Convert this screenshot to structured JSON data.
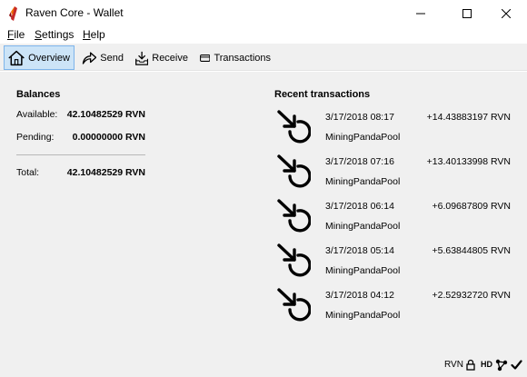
{
  "window": {
    "title": "Raven Core - Wallet"
  },
  "menu": {
    "file": "File",
    "settings": "Settings",
    "help": "Help"
  },
  "toolbar": {
    "overview": "Overview",
    "send": "Send",
    "receive": "Receive",
    "transactions": "Transactions",
    "active": "overview"
  },
  "balances": {
    "title": "Balances",
    "available_label": "Available:",
    "available_value": "42.10482529 RVN",
    "pending_label": "Pending:",
    "pending_value": "0.00000000 RVN",
    "total_label": "Total:",
    "total_value": "42.10482529 RVN"
  },
  "recent": {
    "title": "Recent transactions",
    "items": [
      {
        "date": "3/17/2018 08:17",
        "amount": "+14.43883197 RVN",
        "label": "MiningPandaPool",
        "icon": "mined-icon"
      },
      {
        "date": "3/17/2018 07:16",
        "amount": "+13.40133998 RVN",
        "label": "MiningPandaPool",
        "icon": "mined-icon"
      },
      {
        "date": "3/17/2018 06:14",
        "amount": "+6.09687809 RVN",
        "label": "MiningPandaPool",
        "icon": "mined-icon"
      },
      {
        "date": "3/17/2018 05:14",
        "amount": "+5.63844805 RVN",
        "label": "MiningPandaPool",
        "icon": "mined-icon"
      },
      {
        "date": "3/17/2018 04:12",
        "amount": "+2.52932720 RVN",
        "label": "MiningPandaPool",
        "icon": "mined-icon"
      }
    ]
  },
  "status": {
    "unit": "RVN",
    "hd": "HD"
  },
  "colors": {
    "toolbar_active_bg": "#cce4f7",
    "toolbar_active_border": "#7eb4ea",
    "app_icon": "#c62828"
  }
}
